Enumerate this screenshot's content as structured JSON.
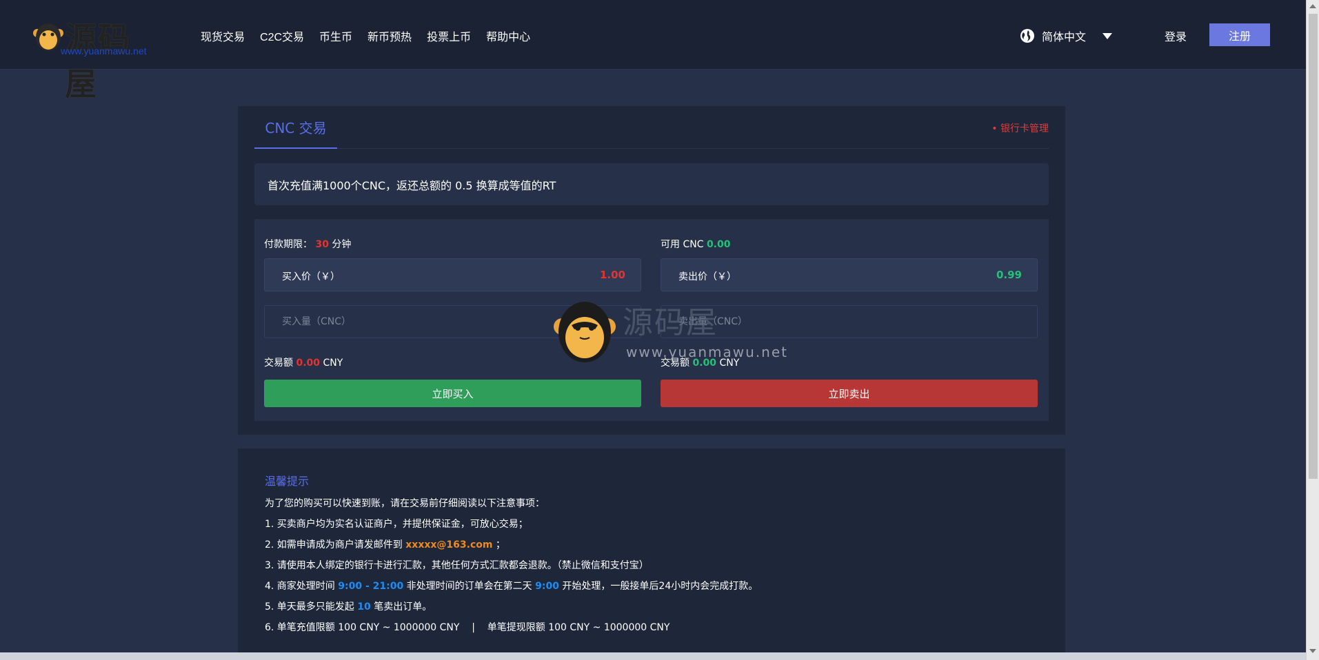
{
  "logo": {
    "text": "源码屋",
    "sub": "www.yuanmawu.net"
  },
  "nav": {
    "items": [
      "现货交易",
      "C2C交易",
      "币生币",
      "新币预热",
      "投票上币",
      "帮助中心"
    ]
  },
  "header": {
    "language": "简体中文",
    "login": "登录",
    "register": "注册"
  },
  "card": {
    "tab": "CNC 交易",
    "bank_link": "• 银行卡管理",
    "notice": "首次充值满1000个CNC，返还总额的 0.5 换算成等值的RT"
  },
  "buy": {
    "meta_prefix": "付款期限：",
    "meta_value": "30",
    "meta_suffix": "分钟",
    "price_label": "买入价（￥）",
    "price_value": "1.00",
    "amount_placeholder": "买入量（CNC）",
    "total_prefix": "交易额",
    "total_value": "0.00",
    "total_unit": "CNY",
    "button": "立即买入"
  },
  "sell": {
    "meta_prefix": "可用 CNC",
    "meta_value": "0.00",
    "price_label": "卖出价（￥）",
    "price_value": "0.99",
    "amount_placeholder": "卖出量（CNC）",
    "total_prefix": "交易额",
    "total_value": "0.00",
    "total_unit": "CNY",
    "button": "立即卖出"
  },
  "tips": {
    "title": "温馨提示",
    "intro": "为了您的购买可以快速到账，请在交易前仔细阅读以下注意事项：",
    "line1": "1. 买卖商户均为实名认证商户，并提供保证金，可放心交易；",
    "line2_a": "2. 如需申请成为商户请发邮件到",
    "line2_email": "xxxxx@163.com",
    "line2_b": "；",
    "line3": "3. 请使用本人绑定的银行卡进行汇款，其他任何方式汇款都会退款。（禁止微信和支付宝）",
    "line4_a": "4. 商家处理时间",
    "line4_time": "9:00 - 21:00",
    "line4_b": "非处理时间的订单会在第二天",
    "line4_time2": "9:00",
    "line4_c": "开始处理，一般接单后24小时内会完成打款。",
    "line5_a": "5. 单天最多只能发起",
    "line5_num": "10",
    "line5_b": "笔卖出订单。",
    "line6": "6. 单笔充值限额 100 CNY ~ 1000000 CNY    |    单笔提现限额 100 CNY ~ 1000000 CNY"
  },
  "watermark": {
    "text": "源码屋",
    "sub": "www.yuanmawu.net"
  },
  "colors": {
    "accent": "#5a6ee8",
    "buy": "#2e9e5a",
    "sell": "#b73636",
    "price_up": "#e8322e",
    "price_down": "#26c07a"
  }
}
